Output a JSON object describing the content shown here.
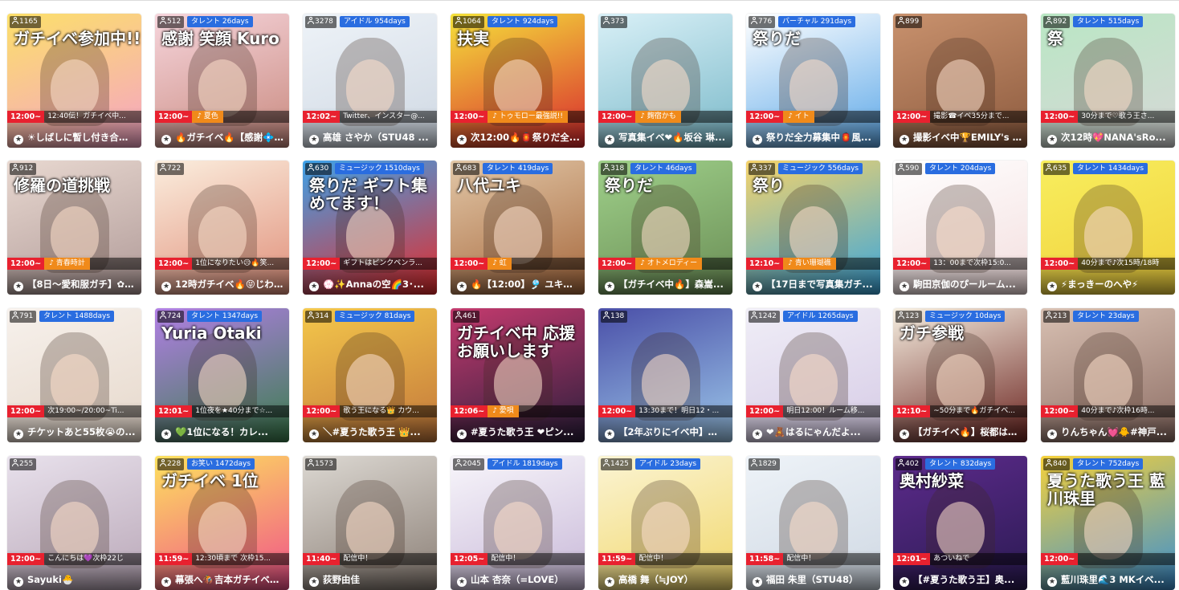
{
  "cards": [
    {
      "viewers": "1165",
      "tag": "",
      "time": "12:00~",
      "sub": "12:40伝！ガチイベ中...",
      "sub_style": "plain",
      "title": "☀しばしに暫し付き合って...",
      "overlay": "ガチイベ参加中!!",
      "colors": [
        "#fce06a",
        "#f5a3c6"
      ]
    },
    {
      "viewers": "512",
      "tag": "タレント 26days",
      "time": "12:00~",
      "sub": "♪ 夏色",
      "sub_style": "orange",
      "title": "🔥ガチイベ🔥【感謝💠...",
      "overlay": "感謝 笑顔 Kuro",
      "colors": [
        "#f6d5dc",
        "#c98a7f"
      ]
    },
    {
      "viewers": "3278",
      "tag": "アイドル 954days",
      "time": "12:02~",
      "sub": "Twitter、インスター@...",
      "sub_style": "plain",
      "title": "高雄 さやか（STU48 ...",
      "overlay": "",
      "colors": [
        "#eef3f8",
        "#cfd8e3"
      ]
    },
    {
      "viewers": "1064",
      "tag": "タレント 924days",
      "time": "12:00~",
      "sub": "♪ トゥモロー最強説!!",
      "sub_style": "orange",
      "title": "次12:00🔥🏮祭りだ全...",
      "overlay": "扶実",
      "colors": [
        "#f5e23b",
        "#d8282e"
      ]
    },
    {
      "viewers": "373",
      "tag": "",
      "time": "12:00~",
      "sub": "♪ 麹宿かも",
      "sub_style": "orange",
      "title": "写真集イベ❤🔥坂谷 琳...",
      "overlay": "",
      "colors": [
        "#d9f0f7",
        "#7ab9c9"
      ]
    },
    {
      "viewers": "776",
      "tag": "バーチャル 291days",
      "time": "12:00~",
      "sub": "♪ イト",
      "sub_style": "orange",
      "title": "祭りだ全力募集中🏮風...",
      "overlay": "祭りだ",
      "colors": [
        "#ffffff",
        "#5da8e8"
      ]
    },
    {
      "viewers": "899",
      "tag": "",
      "time": "12:00~",
      "sub": "撮影☎イベ35分まで...",
      "sub_style": "plain",
      "title": "撮影イベ中🏆EMILY's ro...",
      "overlay": "",
      "colors": [
        "#c9926e",
        "#8c5a3e"
      ]
    },
    {
      "viewers": "892",
      "tag": "タレント 515days",
      "time": "12:00~",
      "sub": "30分まで♡歌う王さ...",
      "sub_style": "plain",
      "title": "次12時💖NANA'sRo...",
      "overlay": "祭",
      "colors": [
        "#b9e7c4",
        "#d7d7d7"
      ]
    },
    {
      "viewers": "912",
      "tag": "",
      "time": "12:00~",
      "sub": "♪ 青春時計",
      "sub_style": "orange",
      "title": "【8日〜愛和服ガチ】✿ ...",
      "overlay": "修羅の道挑戦",
      "colors": [
        "#e8d8d0",
        "#b09a98"
      ]
    },
    {
      "viewers": "722",
      "tag": "",
      "time": "12:00~",
      "sub": "1位になりたい😥🔥笑...",
      "sub_style": "plain",
      "title": "12時ガチイベ🔥😝じわる...",
      "overlay": "",
      "colors": [
        "#fbeede",
        "#e08f7a"
      ]
    },
    {
      "viewers": "630",
      "tag": "ミュージック 1510days",
      "time": "12:00~",
      "sub": "ギフトはピンクペンラ...",
      "sub_style": "plain",
      "title": "💮✨Annaの空🌈3･...",
      "overlay": "祭りだ ギフト集めてます！",
      "colors": [
        "#3da2e9",
        "#e42b2b"
      ]
    },
    {
      "viewers": "683",
      "tag": "タレント 419days",
      "time": "12:00~",
      "sub": "♪ 虹",
      "sub_style": "orange",
      "title": "🔥【12:00】🎐 ユキリ...",
      "overlay": "八代ユキ",
      "colors": [
        "#e2c7a7",
        "#a6683d"
      ]
    },
    {
      "viewers": "318",
      "tag": "タレント 46days",
      "time": "12:00~",
      "sub": "♪ オトメロディー",
      "sub_style": "orange",
      "title": "【ガチイベ中🔥】森嵩...",
      "overlay": "祭りだ",
      "colors": [
        "#9fd08a",
        "#6a8d55"
      ]
    },
    {
      "viewers": "337",
      "tag": "ミュージック 556days",
      "time": "12:10~",
      "sub": "♪ 青い珊瑚礁",
      "sub_style": "orange",
      "title": "【17日まで写真集ガチ...",
      "overlay": "祭り",
      "colors": [
        "#f6d36a",
        "#3aa6dd"
      ]
    },
    {
      "viewers": "590",
      "tag": "タレント 204days",
      "time": "12:00~",
      "sub": "13：00まで次枠15:0...",
      "sub_style": "plain",
      "title": "駒田京伽のぴールーム...",
      "overlay": "",
      "colors": [
        "#ffffff",
        "#f3dede"
      ]
    },
    {
      "viewers": "635",
      "tag": "タレント 1434days",
      "time": "12:00~",
      "sub": "40分まで♪次15時/18時",
      "sub_style": "plain",
      "title": "⚡まっきーのへや⚡",
      "overlay": "",
      "colors": [
        "#f8ee5e",
        "#f0d03c"
      ]
    },
    {
      "viewers": "791",
      "tag": "タレント 1488days",
      "time": "12:00~",
      "sub": "次19:00~/20:00~Ti...",
      "sub_style": "plain",
      "title": "チケットあと55枚😭の...",
      "overlay": "",
      "colors": [
        "#f7f1ec",
        "#e6d8cb"
      ]
    },
    {
      "viewers": "724",
      "tag": "タレント 1347days",
      "time": "12:01~",
      "sub": "1位夜を★40分まで☆...",
      "sub_style": "plain",
      "title": "💚1位になる！カレ...",
      "overlay": "Yuria Otaki",
      "colors": [
        "#b27fe6",
        "#3a7d4c"
      ]
    },
    {
      "viewers": "314",
      "tag": "ミュージック 81days",
      "time": "12:00~",
      "sub": "歌う王になる👑 カウ...",
      "sub_style": "plain",
      "title": "＼#夏うた歌う王 👑...",
      "overlay": "",
      "colors": [
        "#f4c84b",
        "#c3773b"
      ]
    },
    {
      "viewers": "461",
      "tag": "",
      "time": "12:06~",
      "sub": "♪ 愛唄",
      "sub_style": "orange",
      "title": "#夏うた歌う王 ❤ピン...",
      "overlay": "ガチイベ中 応援お願いします",
      "colors": [
        "#c43a6e",
        "#2b1e3c"
      ]
    },
    {
      "viewers": "138",
      "tag": "",
      "time": "12:00~",
      "sub": "13:30まで！明日12・...",
      "sub_style": "plain",
      "title": "【2年ぶりにイベ中】🌫...",
      "overlay": "",
      "colors": [
        "#4a4fa8",
        "#9cc7e9"
      ]
    },
    {
      "viewers": "1242",
      "tag": "アイドル 1265days",
      "time": "12:00~",
      "sub": "明日12:00！ルーム移...",
      "sub_style": "plain",
      "title": "❤🧸はるにゃんだよ...",
      "overlay": "",
      "colors": [
        "#f0eef7",
        "#d6cbe6"
      ]
    },
    {
      "viewers": "123",
      "tag": "ミュージック 10days",
      "time": "12:10~",
      "sub": "~50分まで🔥ガチイベ...",
      "sub_style": "plain",
      "title": "【ガチイベ🔥】桜都はC...",
      "overlay": "ガチ参戦",
      "colors": [
        "#f6efe1",
        "#6b2420"
      ]
    },
    {
      "viewers": "213",
      "tag": "タレント 23days",
      "time": "12:00~",
      "sub": "40分まで♪次枠16時...",
      "sub_style": "plain",
      "title": "りんちゃん💓🐥#神戸...",
      "overlay": "",
      "colors": [
        "#d8c0b2",
        "#8e6f66"
      ]
    },
    {
      "viewers": "255",
      "tag": "",
      "time": "12:00~",
      "sub": "こんにちは💜次枠22じ",
      "sub_style": "plain",
      "title": "Sayuki🐣",
      "overlay": "",
      "colors": [
        "#e8e1ec",
        "#b9a7b7"
      ]
    },
    {
      "viewers": "228",
      "tag": "お笑い 1472days",
      "time": "11:59~",
      "sub": "12:30頃まで 次枠15...",
      "sub_style": "plain",
      "title": "幕張へ🏇吉本ガチイベ🔥...",
      "overlay": "ガチイベ 1位",
      "colors": [
        "#fde25e",
        "#f0508a"
      ]
    },
    {
      "viewers": "1573",
      "tag": "",
      "time": "11:40~",
      "sub": "配信中！",
      "sub_style": "plain",
      "title": "荻野由佳",
      "overlay": "",
      "colors": [
        "#dcd8d2",
        "#8b7f76"
      ]
    },
    {
      "viewers": "2045",
      "tag": "アイドル 1819days",
      "time": "12:05~",
      "sub": "配信中！",
      "sub_style": "plain",
      "title": "山本 杏奈（=LOVE）",
      "overlay": "",
      "colors": [
        "#f8f6fb",
        "#c8b8d8"
      ]
    },
    {
      "viewers": "1425",
      "tag": "アイドル 23days",
      "time": "11:59~",
      "sub": "配信中！",
      "sub_style": "plain",
      "title": "高橋 舞（≒JOY）",
      "overlay": "",
      "colors": [
        "#fbf4d4",
        "#f1d76a"
      ]
    },
    {
      "viewers": "1829",
      "tag": "",
      "time": "11:58~",
      "sub": "配信中！",
      "sub_style": "plain",
      "title": "福田 朱里（STU48）",
      "overlay": "",
      "colors": [
        "#eef3f8",
        "#cfd8e3"
      ]
    },
    {
      "viewers": "402",
      "tag": "タレント 832days",
      "time": "12:01~",
      "sub": "あついねで",
      "sub_style": "plain",
      "title": "【#夏うた歌う王】奥...",
      "overlay": "奥村紗菜",
      "colors": [
        "#5d2b8c",
        "#2a1a52"
      ]
    },
    {
      "viewers": "840",
      "tag": "タレント 752days",
      "time": "12:00~",
      "sub": "",
      "sub_style": "plain",
      "title": "藍川珠里🌊3 MKイベ...",
      "overlay": "夏うた歌う王 藍川珠里",
      "colors": [
        "#f6d13a",
        "#3a8fd2"
      ]
    }
  ]
}
